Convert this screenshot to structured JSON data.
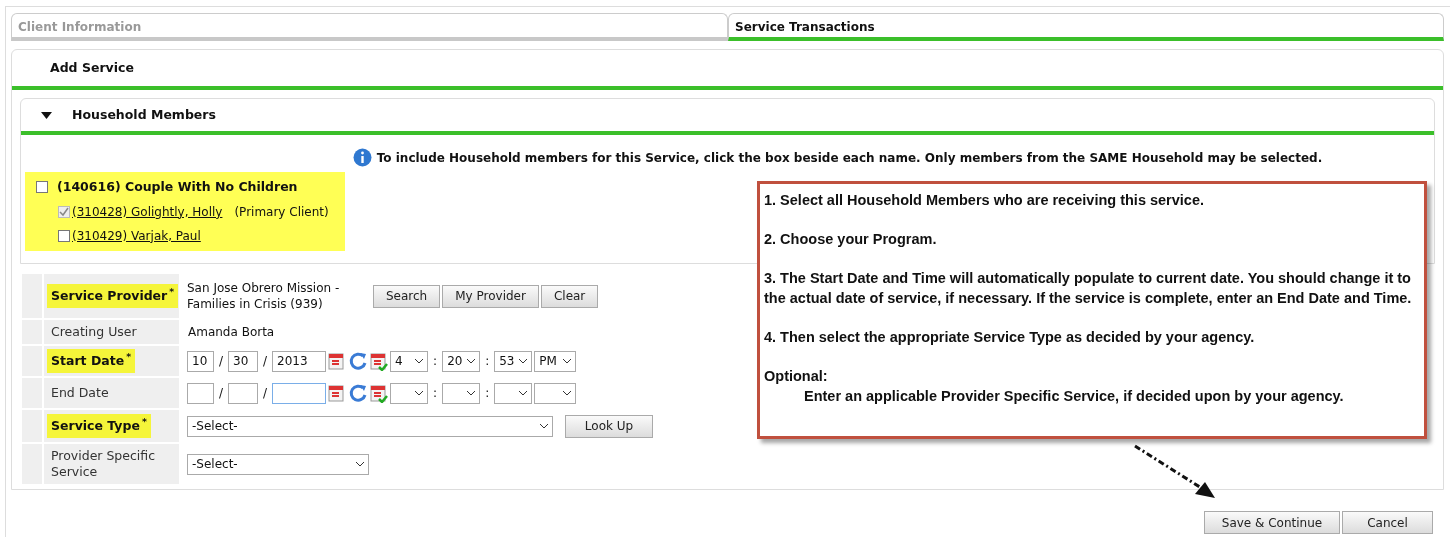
{
  "tabs": [
    {
      "label": "Client Information",
      "selected": false
    },
    {
      "label": "Service Transactions",
      "selected": true
    }
  ],
  "section_title": "Add Service",
  "household": {
    "title": "Household Members",
    "expanded": true,
    "info": "To include Household members for this Service, click the box beside each name. Only members from the SAME Household may be selected.",
    "group": {
      "label": "(140616) Couple With No Children",
      "checked": false
    },
    "members": [
      {
        "label": "(310428) Golightly, Holly",
        "note": "(Primary Client)",
        "checked": true,
        "disabled": true
      },
      {
        "label": "(310429) Varjak, Paul",
        "checked": false,
        "disabled": false
      }
    ]
  },
  "form": {
    "required_mark": "*",
    "date_separator": "/",
    "time_separator": ":",
    "rows": [
      {
        "kind": "provider",
        "label": "Service Provider",
        "required": true,
        "value": "San Jose Obrero Mission - Families in Crisis (939)",
        "buttons": [
          "Search",
          "My Provider",
          "Clear"
        ]
      },
      {
        "kind": "text",
        "label": "Creating User",
        "required": false,
        "value": "Amanda Borta"
      },
      {
        "kind": "datetime",
        "label": "Start Date",
        "required": true,
        "month": "10",
        "day": "30",
        "year": "2013",
        "hour": "4",
        "minute": "20",
        "second": "53",
        "ampm": "PM",
        "year_focused": false
      },
      {
        "kind": "datetime",
        "label": "End Date",
        "required": false,
        "year_focused": true
      },
      {
        "kind": "select",
        "label": "Service Type",
        "required": true,
        "value": "-Select-",
        "button": "Look Up"
      },
      {
        "kind": "select",
        "label": "Provider Specific Service",
        "required": false,
        "value": "-Select-"
      }
    ]
  },
  "callout": {
    "steps": [
      "1. Select all Household Members who are receiving this service.",
      "2. Choose your Program.",
      "3. The Start Date and Time will automatically populate to current date. You should change it to the actual date of service, if necessary. If the service is complete, enter an End Date and Time.",
      "4. Then select the appropriate Service Type as decided by your agency."
    ],
    "optional_title": "Optional:",
    "optional_text": "Enter an applicable Provider Specific Service, if decided upon by your agency."
  },
  "footer_buttons": [
    "Save & Continue",
    "Cancel"
  ]
}
